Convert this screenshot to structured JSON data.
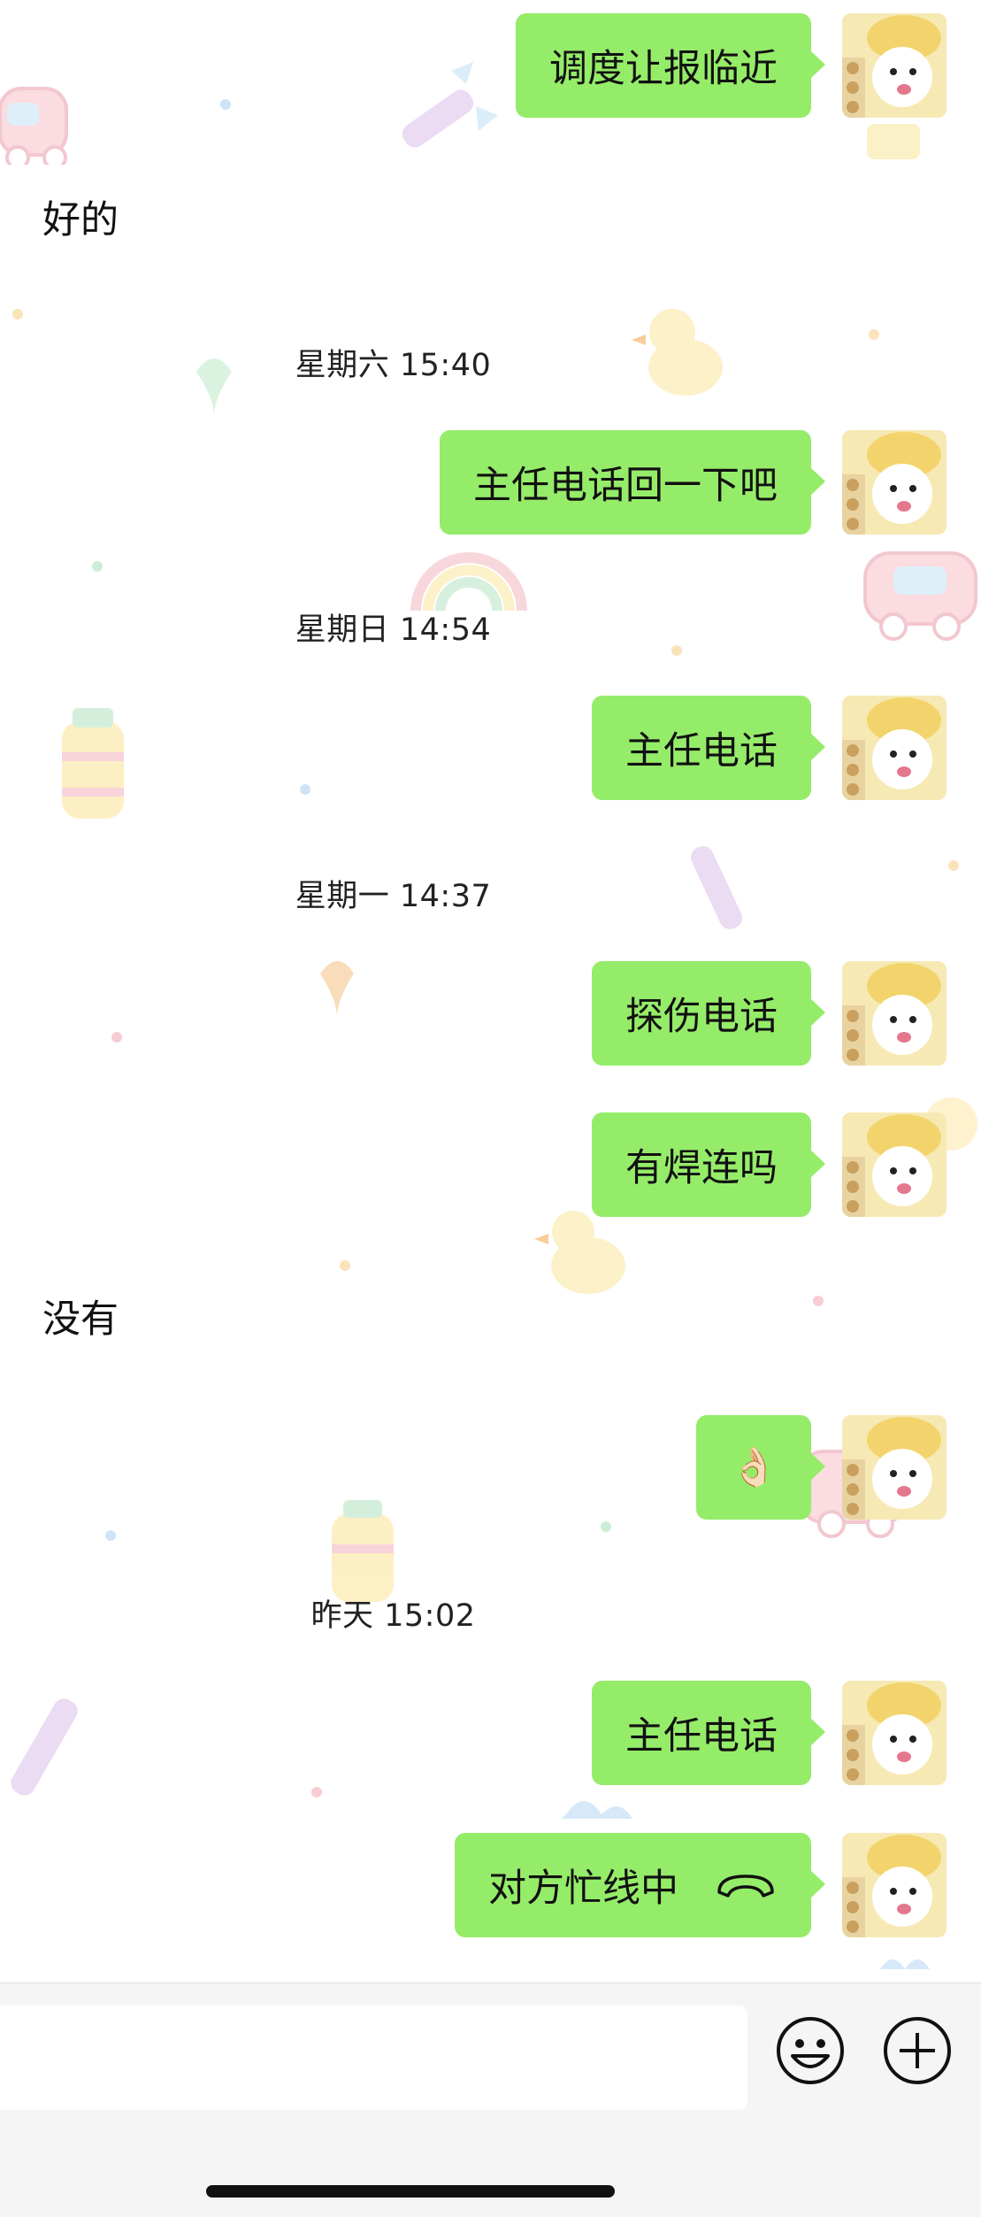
{
  "messages": [
    {
      "side": "out",
      "text": "调度让报临近"
    },
    {
      "side": "in",
      "text": "好的"
    },
    {
      "type": "time",
      "text": "星期六 15:40"
    },
    {
      "side": "out",
      "text": "主任电话回一下吧"
    },
    {
      "type": "time",
      "text": "星期日 14:54"
    },
    {
      "side": "out",
      "text": "主任电话"
    },
    {
      "type": "time",
      "text": "星期一 14:37"
    },
    {
      "side": "out",
      "text": "探伤电话"
    },
    {
      "side": "out",
      "text": "有焊连吗"
    },
    {
      "side": "in",
      "text": "没有"
    },
    {
      "side": "out",
      "text": "👌🏻"
    },
    {
      "type": "time",
      "text": "昨天 15:02"
    },
    {
      "side": "out",
      "text": "主任电话"
    },
    {
      "side": "out",
      "text": "对方忙线中",
      "icon": "hangup-icon"
    }
  ],
  "input_bar": {
    "input_value": "",
    "buttons": [
      "emoji-icon",
      "plus-icon"
    ]
  },
  "colors": {
    "outgoing_bubble": "#95ec69",
    "incoming_bubble": "#ffffff",
    "input_bar_bg": "#f5f5f5"
  }
}
